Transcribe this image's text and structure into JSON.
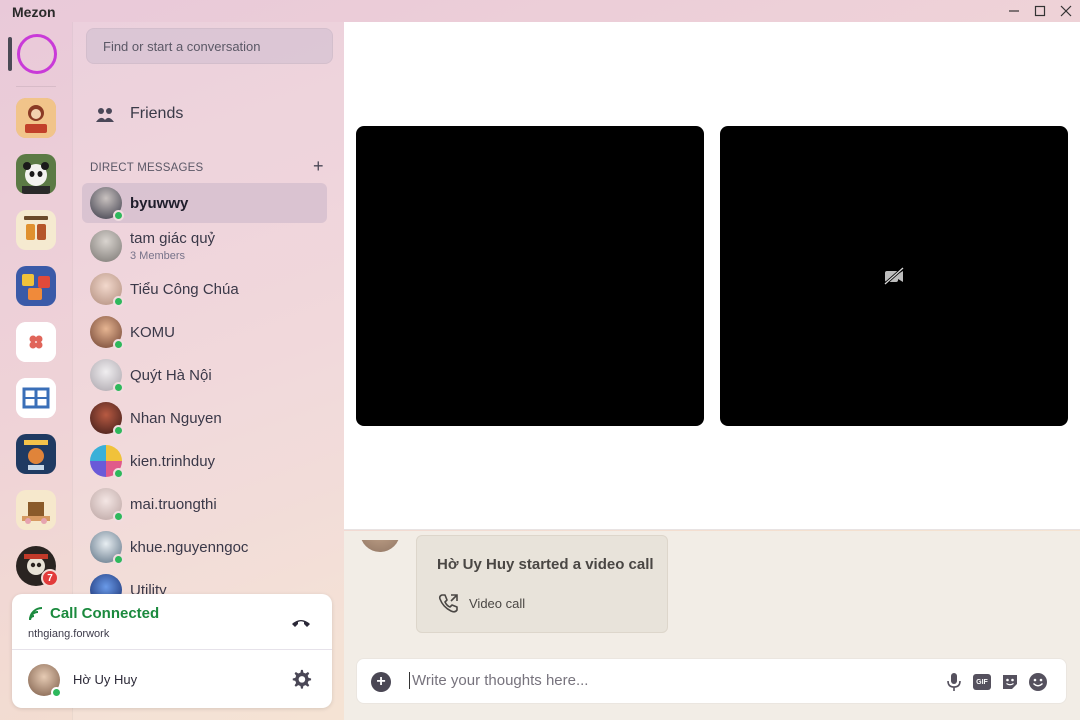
{
  "window": {
    "title": "Mezon",
    "controls": [
      "minimize",
      "maximize",
      "close"
    ]
  },
  "rail": {
    "servers": [
      {
        "name": "server-coba",
        "label": "Cô Ba",
        "color": "#d79a63"
      },
      {
        "name": "server-panda",
        "color": "#4a6a3c"
      },
      {
        "name": "server-tra-da",
        "label": "TRÀ ĐÁ CÔNG AN",
        "color": "#f3e7c6"
      },
      {
        "name": "server-games",
        "color": "#3d5ea8"
      },
      {
        "name": "server-flower",
        "color": "#ffffff"
      },
      {
        "name": "server-logo-blue",
        "color": "#ffffff"
      },
      {
        "name": "server-freelancer",
        "label": "FREELANCER",
        "color": "#1e3a63"
      },
      {
        "name": "server-house",
        "color": "#f4e4c8"
      },
      {
        "name": "server-skull",
        "color": "#3a2e2a",
        "badge": "7"
      }
    ]
  },
  "search": {
    "placeholder": "Find or start a conversation"
  },
  "friends": {
    "label": "Friends"
  },
  "dm": {
    "heading": "DIRECT MESSAGES",
    "add": "+",
    "items": [
      {
        "name": "byuwwy",
        "online": true,
        "active": true,
        "color": "#3a3a48"
      },
      {
        "name": "tam giác quỷ",
        "sub": "3 Members",
        "online": false,
        "color": "#8d8a86"
      },
      {
        "name": "Tiểu Công Chúa",
        "online": true,
        "color": "#e2c3b8"
      },
      {
        "name": "KOMU",
        "online": true,
        "color": "#c58d6b"
      },
      {
        "name": "Quýt Hà Nội",
        "online": true,
        "color": "#d8d4d8"
      },
      {
        "name": "Nhan Nguyen",
        "online": true,
        "color": "#7a3a30"
      },
      {
        "name": "kien.trinhduy",
        "online": true,
        "color": "#d9b54a"
      },
      {
        "name": "mai.truongthi",
        "online": true,
        "color": "#e6d3d2"
      },
      {
        "name": "khue.nguyenngoc",
        "online": true,
        "color": "#b9c6cf"
      },
      {
        "name": "Utility",
        "online": false,
        "color": "#1f3f8a"
      }
    ]
  },
  "call": {
    "status": "Call Connected",
    "user": "nthgiang.forwork",
    "me": "Hờ Uy Huy",
    "accent": "#1b8a3e"
  },
  "message": {
    "title": "Hờ Uy Huy started a video call",
    "action": "Video call"
  },
  "composer": {
    "placeholder": "Write your thoughts here...",
    "gif": "GIF"
  }
}
